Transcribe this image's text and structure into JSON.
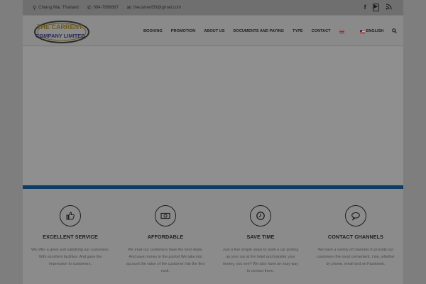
{
  "topbar": {
    "location": "Chiang Mai, Thailand",
    "phone": "094-7896887",
    "email": "thecarrent59@gmail.com",
    "social": [
      "facebook-icon",
      "youtube-icon",
      "rss-icon"
    ]
  },
  "logo": {
    "line1": "THE CARRENT",
    "line2": "COMPANY LIMITED"
  },
  "nav": {
    "items": [
      "BOOKING",
      "PROMOTION",
      "ABOUT US",
      "DOCUMENTS AND PAYING",
      "TYPE",
      "CONTACT"
    ],
    "language": "ENGLISH"
  },
  "features": [
    {
      "icon": "thumbs-up-icon",
      "title": "EXCELLENT SERVICE",
      "text": "We offer a great and satisfying our customers. With excellent facilities. And gave the impression to customers."
    },
    {
      "icon": "money-icon",
      "title": "AFFORDABLE",
      "text": "We treat our customers have the best deals. And save money in the pocket We take into account the value of the customer into the first rank."
    },
    {
      "icon": "clock-icon",
      "title": "SAVE TIME",
      "text": "Just a few simple steps to book a car picking up your car at the hotel and transfer your money, you see? We also have an easy way to contact them."
    },
    {
      "icon": "chat-icon",
      "title": "CONTACT CHANNELS",
      "text": "We have a variety of channels to provide our customers the most convenient. Line, whether by phone, email and on Facebook."
    }
  ],
  "colors": {
    "accent_bar": "#0f3c66",
    "overlay_bg": "#7e7e7e"
  }
}
